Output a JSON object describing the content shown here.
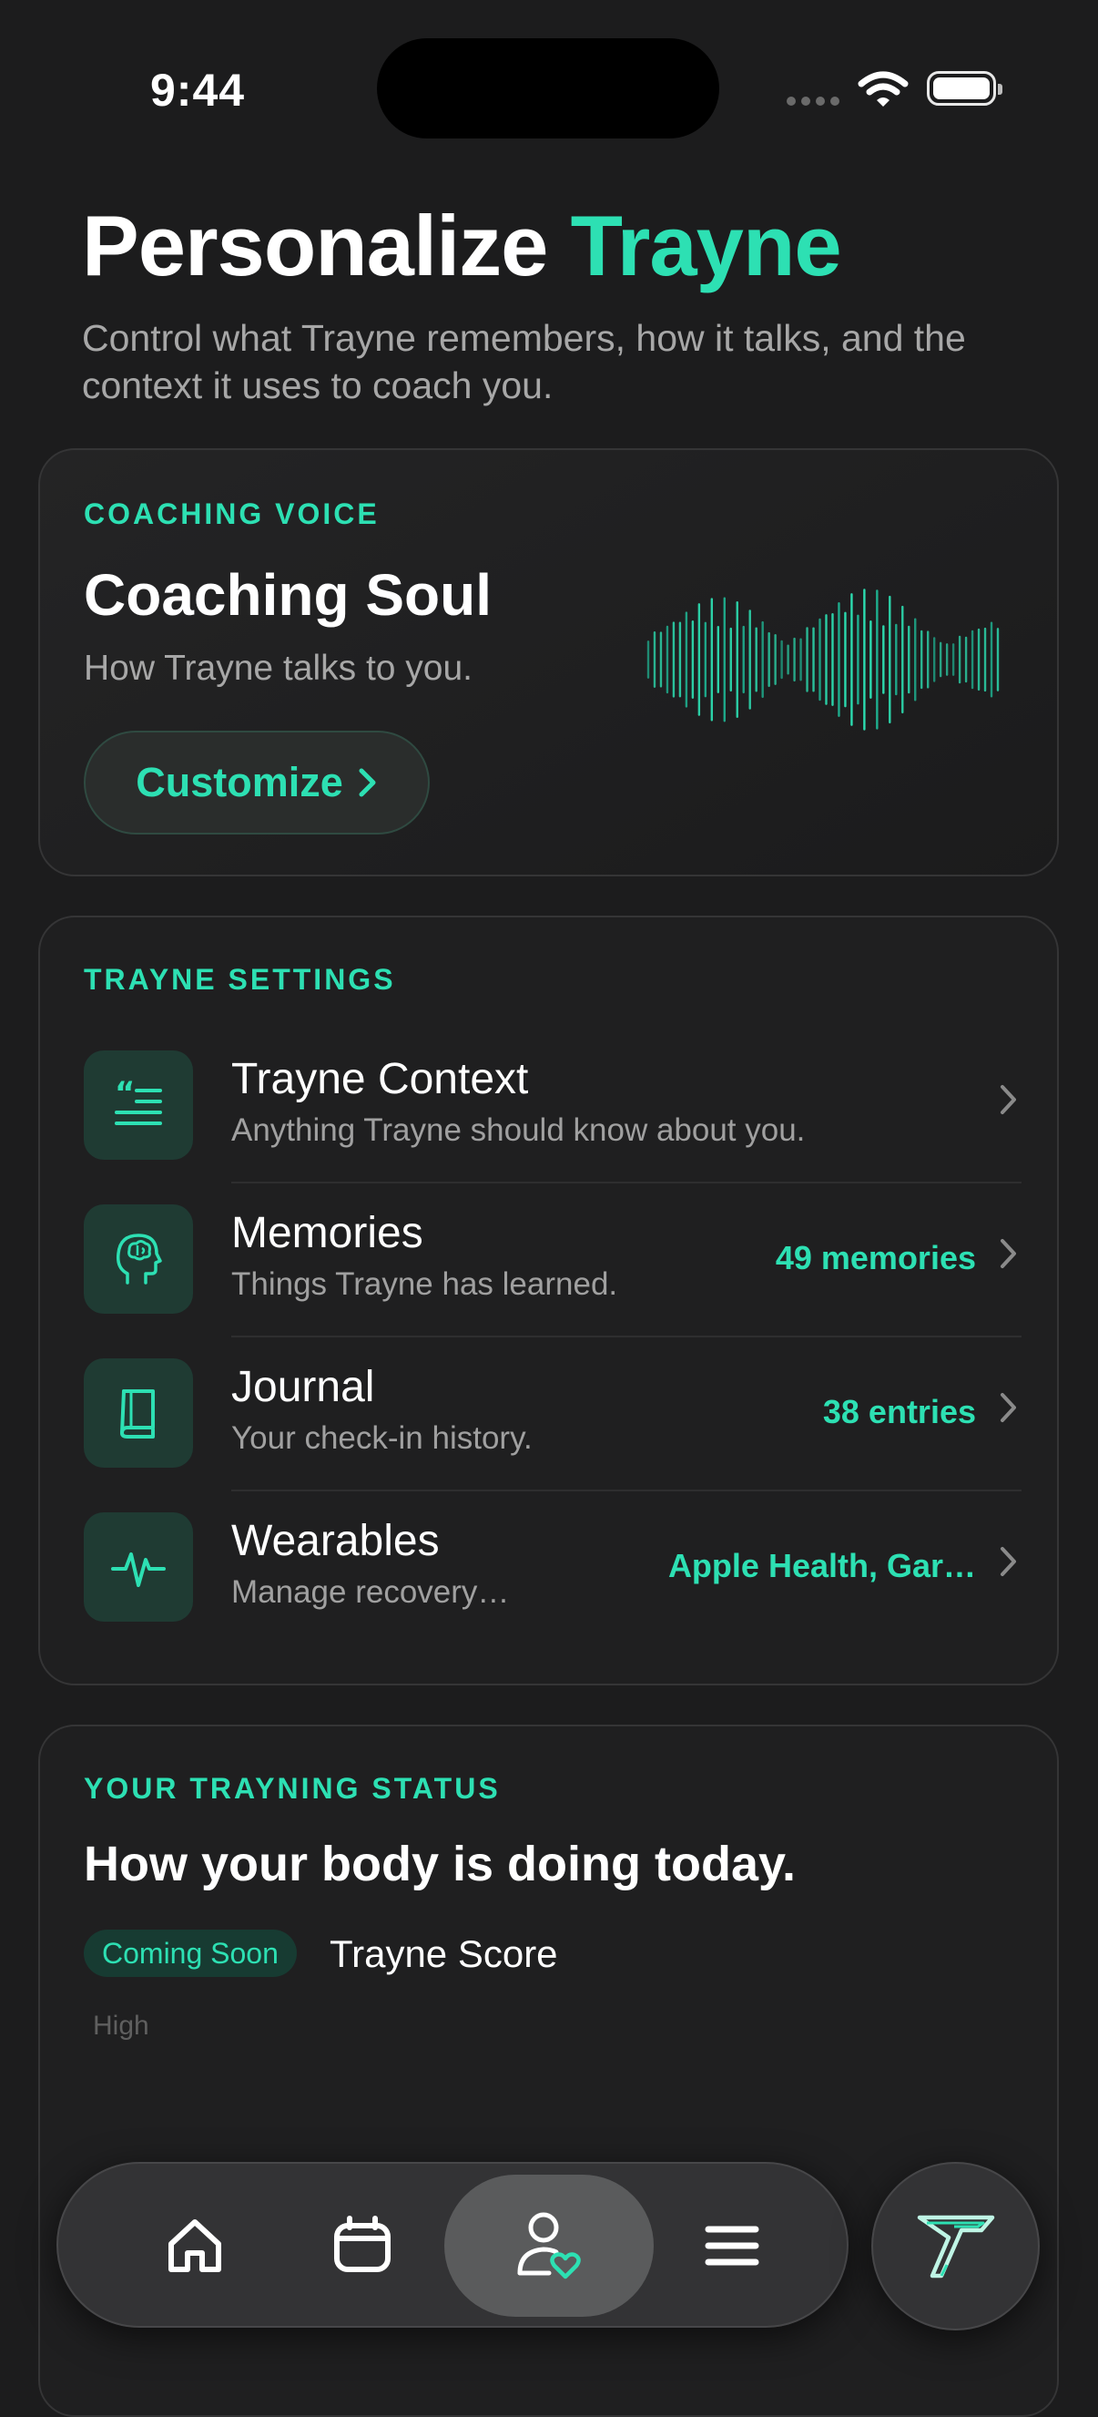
{
  "status_bar": {
    "time": "9:44"
  },
  "header": {
    "title_part1": "Personalize ",
    "title_part2": "Trayne",
    "subtitle": "Control what Trayne remembers, how it talks, and the context it uses to coach you."
  },
  "voice_card": {
    "eyebrow": "COACHING VOICE",
    "title": "Coaching Soul",
    "subtitle": "How Trayne talks to you.",
    "button_label": "Customize"
  },
  "settings_card": {
    "eyebrow": "TRAYNE SETTINGS",
    "items": [
      {
        "title": "Trayne Context",
        "subtitle": "Anything Trayne should know about you.",
        "value": "",
        "icon": "quote-lines-icon"
      },
      {
        "title": "Memories",
        "subtitle": "Things Trayne has learned.",
        "value": "49 memories",
        "icon": "brain-head-icon"
      },
      {
        "title": "Journal",
        "subtitle": "Your check-in history.",
        "value": "38 entries",
        "icon": "book-icon"
      },
      {
        "title": "Wearables",
        "subtitle": "Manage recovery…",
        "value": "Apple Health, Gar…",
        "icon": "pulse-icon"
      }
    ]
  },
  "status_card": {
    "eyebrow": "YOUR TRAYNING STATUS",
    "title": "How your body is doing today.",
    "badge": "Coming Soon",
    "score_label": "Trayne Score",
    "level_label": "High"
  },
  "tab_bar": {
    "tabs": [
      "home-icon",
      "calendar-icon",
      "profile-heart-icon",
      "menu-icon"
    ],
    "active": "profile-heart-icon",
    "fab_icon": "trayne-logo-icon"
  },
  "colors": {
    "accent": "#2de0b3",
    "background": "#1c1c1d",
    "card": "#1f1f20"
  }
}
